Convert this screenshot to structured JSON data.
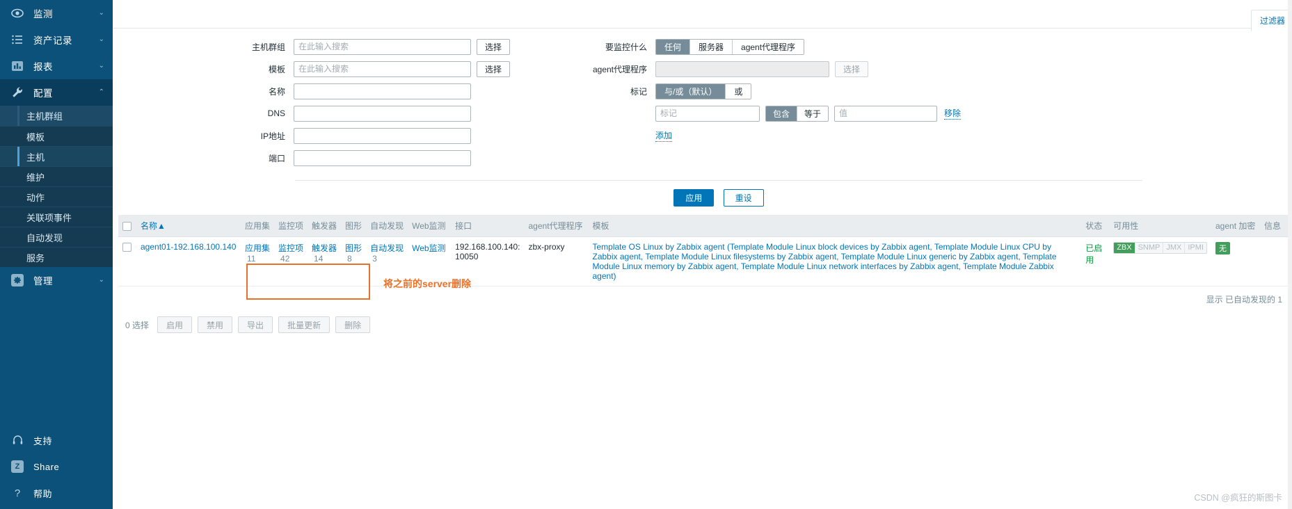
{
  "sidebar": {
    "top_items": [
      {
        "label": "监测",
        "icon": "eye-icon",
        "chevron": "⌄",
        "expanded": false
      },
      {
        "label": "资产记录",
        "icon": "list-icon",
        "chevron": "⌄",
        "expanded": false
      },
      {
        "label": "报表",
        "icon": "bar-chart-icon",
        "chevron": "⌄",
        "expanded": false
      },
      {
        "label": "配置",
        "icon": "wrench-icon",
        "chevron": "⌃",
        "expanded": true
      }
    ],
    "submenu": [
      {
        "label": "主机群组",
        "state": "hovered"
      },
      {
        "label": "模板",
        "state": "normal"
      },
      {
        "label": "主机",
        "state": "selected"
      },
      {
        "label": "维护",
        "state": "normal"
      },
      {
        "label": "动作",
        "state": "normal"
      },
      {
        "label": "关联项事件",
        "state": "normal"
      },
      {
        "label": "自动发现",
        "state": "normal"
      },
      {
        "label": "服务",
        "state": "normal"
      }
    ],
    "admin_item": {
      "label": "管理",
      "icon": "gear-icon",
      "chevron": "⌄"
    },
    "bottom_items": [
      {
        "label": "支持",
        "icon": "headset-icon"
      },
      {
        "label": "Share",
        "icon": "zabbix-share-icon"
      },
      {
        "label": "帮助",
        "icon": "question-icon"
      }
    ]
  },
  "topbar": {
    "filter_tab": "过滤器"
  },
  "filter": {
    "left_fields": [
      {
        "label": "主机群组",
        "value": "",
        "placeholder": "在此输入搜索",
        "has_select": true,
        "select_label": "选择"
      },
      {
        "label": "模板",
        "value": "",
        "placeholder": "在此输入搜索",
        "has_select": true,
        "select_label": "选择"
      },
      {
        "label": "名称",
        "value": "",
        "placeholder": "",
        "has_select": false
      },
      {
        "label": "DNS",
        "value": "",
        "placeholder": "",
        "has_select": false
      },
      {
        "label": "IP地址",
        "value": "",
        "placeholder": "",
        "has_select": false
      },
      {
        "label": "端口",
        "value": "",
        "placeholder": "",
        "has_select": false
      }
    ],
    "monitored_by": {
      "label": "要监控什么",
      "options": [
        "任何",
        "服务器",
        "agent代理程序"
      ],
      "selected": "任何"
    },
    "proxy": {
      "label": "agent代理程序",
      "value": "",
      "placeholder": "",
      "select_label": "选择",
      "disabled": true
    },
    "tags": {
      "label": "标记",
      "operator_options": [
        "与/或（默认）",
        "或"
      ],
      "operator_selected": "与/或（默认）",
      "rows": [
        {
          "tag_value": "",
          "tag_placeholder": "标记",
          "match_options": [
            "包含",
            "等于"
          ],
          "match_selected": "包含",
          "value_value": "",
          "value_placeholder": "值",
          "remove_label": "移除"
        }
      ],
      "add_label": "添加"
    },
    "apply_label": "应用",
    "reset_label": "重设"
  },
  "table": {
    "columns": [
      "名称",
      "应用集",
      "监控项",
      "触发器",
      "图形",
      "自动发现",
      "Web监测",
      "接口",
      "agent代理程序",
      "模板",
      "状态",
      "可用性",
      "agent 加密",
      "信息"
    ],
    "sorted_column": "名称",
    "sort_indicator": "▲",
    "rows": [
      {
        "selected": false,
        "name": "agent01-192.168.100.140",
        "applications": {
          "label": "应用集",
          "count": "11"
        },
        "items": {
          "label": "监控项",
          "count": "42"
        },
        "triggers": {
          "label": "触发器",
          "count": "14"
        },
        "graphs": {
          "label": "图形",
          "count": "8"
        },
        "discovery": {
          "label": "自动发现",
          "count": "3"
        },
        "web": {
          "label": "Web监测",
          "count": ""
        },
        "interface": "192.168.100.140: 10050",
        "proxy": "zbx-proxy",
        "templates": "Template OS Linux by Zabbix agent (Template Module Linux block devices by Zabbix agent, Template Module Linux CPU by Zabbix agent, Template Module Linux filesystems by Zabbix agent, Template Module Linux generic by Zabbix agent, Template Module Linux memory by Zabbix agent, Template Module Linux network interfaces by Zabbix agent, Template Module Zabbix agent)",
        "status": "已启用",
        "availability": [
          {
            "label": "ZBX",
            "active": true
          },
          {
            "label": "SNMP",
            "active": false
          },
          {
            "label": "JMX",
            "active": false
          },
          {
            "label": "IPMI",
            "active": false
          }
        ],
        "encryption": "无",
        "info": ""
      }
    ],
    "displaying_text": "显示 已自动发现的 1"
  },
  "footer": {
    "selection_count": "0 选择",
    "buttons": [
      "启用",
      "禁用",
      "导出",
      "批量更新",
      "删除"
    ]
  },
  "annotation": {
    "note": "将之前的server删除",
    "color": "#e8722a"
  },
  "watermark": "CSDN @疯狂的斯图卡"
}
